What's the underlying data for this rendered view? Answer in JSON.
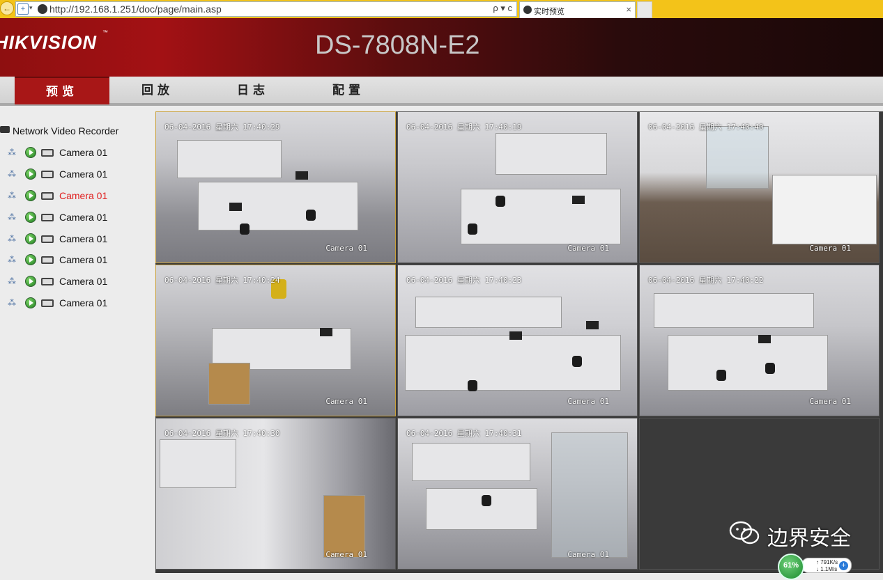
{
  "browser": {
    "url": "http://192.168.1.251/doc/page/main.asp",
    "url_tools": "ρ ▾ c",
    "tab_title": "实时预览",
    "tab_close": "×",
    "page_icon": "+",
    "page_icon_arrow": "▾",
    "back_icon": "←"
  },
  "header": {
    "logo": "HIKVISION",
    "logo_tm": "™",
    "model": "DS-7808N-E2"
  },
  "nav": {
    "items": [
      {
        "label": "预览",
        "active": true
      },
      {
        "label": "回放",
        "active": false
      },
      {
        "label": "日志",
        "active": false
      },
      {
        "label": "配置",
        "active": false
      }
    ]
  },
  "sidebar": {
    "root_label": "Network Video Recorder",
    "share_icon": "⁂",
    "cameras": [
      {
        "label": "Camera 01",
        "selected": false
      },
      {
        "label": "Camera 01",
        "selected": false
      },
      {
        "label": "Camera 01",
        "selected": true
      },
      {
        "label": "Camera 01",
        "selected": false
      },
      {
        "label": "Camera 01",
        "selected": false
      },
      {
        "label": "Camera 01",
        "selected": false
      },
      {
        "label": "Camera 01",
        "selected": false
      },
      {
        "label": "Camera 01",
        "selected": false
      }
    ]
  },
  "tiles": [
    {
      "timestamp": "06-04-2016 星期六 17:40:29",
      "camera": "Camera 01"
    },
    {
      "timestamp": "06-04-2016 星期六 17:40:19",
      "camera": "Camera 01"
    },
    {
      "timestamp": "06-04-2016 星期六 17:40:40",
      "camera": "Camera 01"
    },
    {
      "timestamp": "06-04-2016 星期六 17:40:24",
      "camera": "Camera 01"
    },
    {
      "timestamp": "06-04-2016 星期六 17:40:23",
      "camera": "Camera 01"
    },
    {
      "timestamp": "06-04-2016 星期六 17:40:22",
      "camera": "Camera 01"
    },
    {
      "timestamp": "06-04-2016 星期六 17:40:30",
      "camera": "Camera 01"
    },
    {
      "timestamp": "06-04-2016 星期六 17:40:31",
      "camera": "Camera 01"
    }
  ],
  "watermark": {
    "text": "边界安全",
    "icon": "wechat-icon"
  },
  "net_meter": {
    "percent": "61%",
    "up": "↑ 791K/s",
    "down": "↓ 1.1M/s",
    "plus": "+"
  },
  "colors": {
    "brand_red": "#a81717",
    "selected_camera": "#e01f1f",
    "browser_bar": "#f3c319"
  }
}
